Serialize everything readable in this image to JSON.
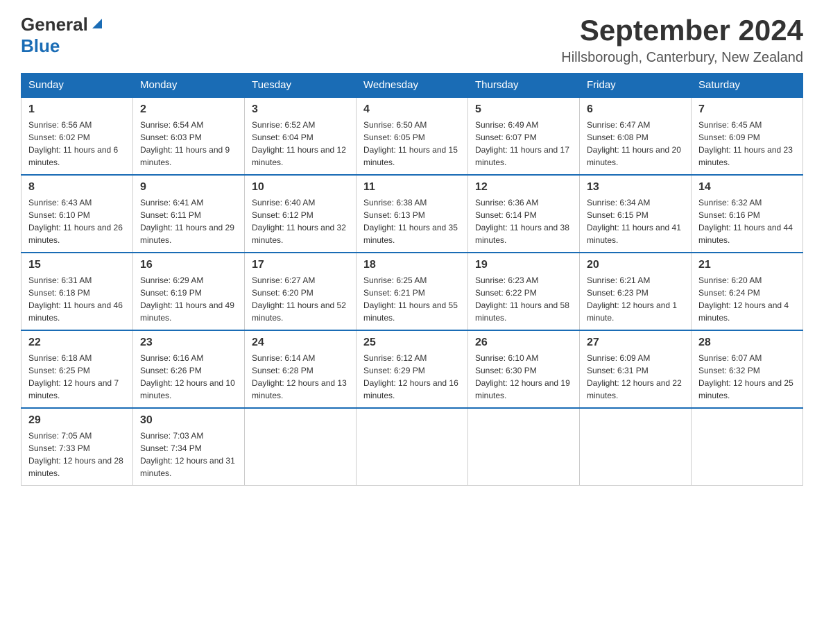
{
  "header": {
    "logo_general": "General",
    "logo_blue": "Blue",
    "month_title": "September 2024",
    "location": "Hillsborough, Canterbury, New Zealand"
  },
  "days_of_week": [
    "Sunday",
    "Monday",
    "Tuesday",
    "Wednesday",
    "Thursday",
    "Friday",
    "Saturday"
  ],
  "weeks": [
    [
      {
        "day": "1",
        "sunrise": "6:56 AM",
        "sunset": "6:02 PM",
        "daylight": "11 hours and 6 minutes."
      },
      {
        "day": "2",
        "sunrise": "6:54 AM",
        "sunset": "6:03 PM",
        "daylight": "11 hours and 9 minutes."
      },
      {
        "day": "3",
        "sunrise": "6:52 AM",
        "sunset": "6:04 PM",
        "daylight": "11 hours and 12 minutes."
      },
      {
        "day": "4",
        "sunrise": "6:50 AM",
        "sunset": "6:05 PM",
        "daylight": "11 hours and 15 minutes."
      },
      {
        "day": "5",
        "sunrise": "6:49 AM",
        "sunset": "6:07 PM",
        "daylight": "11 hours and 17 minutes."
      },
      {
        "day": "6",
        "sunrise": "6:47 AM",
        "sunset": "6:08 PM",
        "daylight": "11 hours and 20 minutes."
      },
      {
        "day": "7",
        "sunrise": "6:45 AM",
        "sunset": "6:09 PM",
        "daylight": "11 hours and 23 minutes."
      }
    ],
    [
      {
        "day": "8",
        "sunrise": "6:43 AM",
        "sunset": "6:10 PM",
        "daylight": "11 hours and 26 minutes."
      },
      {
        "day": "9",
        "sunrise": "6:41 AM",
        "sunset": "6:11 PM",
        "daylight": "11 hours and 29 minutes."
      },
      {
        "day": "10",
        "sunrise": "6:40 AM",
        "sunset": "6:12 PM",
        "daylight": "11 hours and 32 minutes."
      },
      {
        "day": "11",
        "sunrise": "6:38 AM",
        "sunset": "6:13 PM",
        "daylight": "11 hours and 35 minutes."
      },
      {
        "day": "12",
        "sunrise": "6:36 AM",
        "sunset": "6:14 PM",
        "daylight": "11 hours and 38 minutes."
      },
      {
        "day": "13",
        "sunrise": "6:34 AM",
        "sunset": "6:15 PM",
        "daylight": "11 hours and 41 minutes."
      },
      {
        "day": "14",
        "sunrise": "6:32 AM",
        "sunset": "6:16 PM",
        "daylight": "11 hours and 44 minutes."
      }
    ],
    [
      {
        "day": "15",
        "sunrise": "6:31 AM",
        "sunset": "6:18 PM",
        "daylight": "11 hours and 46 minutes."
      },
      {
        "day": "16",
        "sunrise": "6:29 AM",
        "sunset": "6:19 PM",
        "daylight": "11 hours and 49 minutes."
      },
      {
        "day": "17",
        "sunrise": "6:27 AM",
        "sunset": "6:20 PM",
        "daylight": "11 hours and 52 minutes."
      },
      {
        "day": "18",
        "sunrise": "6:25 AM",
        "sunset": "6:21 PM",
        "daylight": "11 hours and 55 minutes."
      },
      {
        "day": "19",
        "sunrise": "6:23 AM",
        "sunset": "6:22 PM",
        "daylight": "11 hours and 58 minutes."
      },
      {
        "day": "20",
        "sunrise": "6:21 AM",
        "sunset": "6:23 PM",
        "daylight": "12 hours and 1 minute."
      },
      {
        "day": "21",
        "sunrise": "6:20 AM",
        "sunset": "6:24 PM",
        "daylight": "12 hours and 4 minutes."
      }
    ],
    [
      {
        "day": "22",
        "sunrise": "6:18 AM",
        "sunset": "6:25 PM",
        "daylight": "12 hours and 7 minutes."
      },
      {
        "day": "23",
        "sunrise": "6:16 AM",
        "sunset": "6:26 PM",
        "daylight": "12 hours and 10 minutes."
      },
      {
        "day": "24",
        "sunrise": "6:14 AM",
        "sunset": "6:28 PM",
        "daylight": "12 hours and 13 minutes."
      },
      {
        "day": "25",
        "sunrise": "6:12 AM",
        "sunset": "6:29 PM",
        "daylight": "12 hours and 16 minutes."
      },
      {
        "day": "26",
        "sunrise": "6:10 AM",
        "sunset": "6:30 PM",
        "daylight": "12 hours and 19 minutes."
      },
      {
        "day": "27",
        "sunrise": "6:09 AM",
        "sunset": "6:31 PM",
        "daylight": "12 hours and 22 minutes."
      },
      {
        "day": "28",
        "sunrise": "6:07 AM",
        "sunset": "6:32 PM",
        "daylight": "12 hours and 25 minutes."
      }
    ],
    [
      {
        "day": "29",
        "sunrise": "7:05 AM",
        "sunset": "7:33 PM",
        "daylight": "12 hours and 28 minutes."
      },
      {
        "day": "30",
        "sunrise": "7:03 AM",
        "sunset": "7:34 PM",
        "daylight": "12 hours and 31 minutes."
      },
      null,
      null,
      null,
      null,
      null
    ]
  ],
  "labels": {
    "sunrise": "Sunrise:",
    "sunset": "Sunset:",
    "daylight": "Daylight:"
  }
}
